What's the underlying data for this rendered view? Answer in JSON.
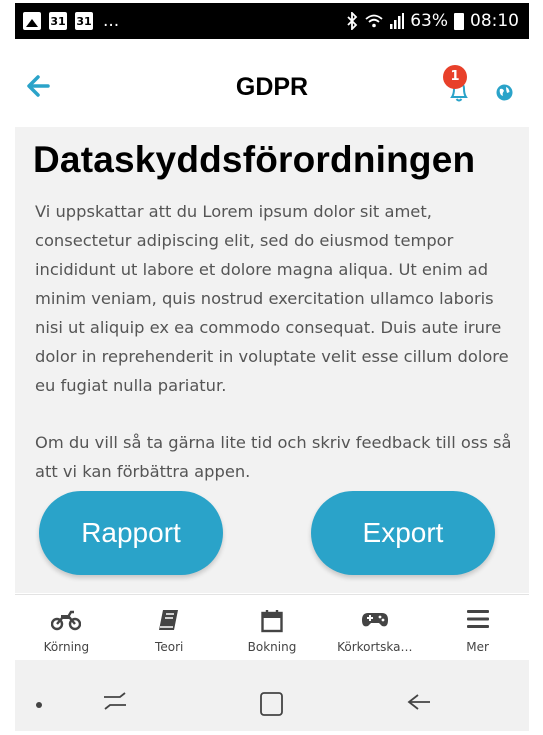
{
  "status_bar": {
    "left_icons": [
      "image-icon",
      "calendar-icon",
      "calendar-icon"
    ],
    "calendar_day": "31",
    "overflow": "...",
    "battery": "63%",
    "time": "08:10"
  },
  "header": {
    "title": "GDPR",
    "notification_count": "1"
  },
  "content": {
    "heading": "Dataskyddsförordningen",
    "paragraph1": "Vi uppskattar att du Lorem ipsum dolor sit amet, consectetur adipiscing elit, sed do eiusmod tempor incididunt ut labore et dolore magna aliqua. Ut enim ad minim veniam, quis nostrud exercitation ullamco laboris nisi ut aliquip ex ea commodo consequat. Duis aute irure dolor in reprehenderit in voluptate velit esse cillum dolore eu fugiat nulla pariatur.",
    "paragraph2": "Om du vill så ta gärna lite tid och skriv feedback till oss så att vi kan förbättra appen."
  },
  "buttons": {
    "rapport": "Rapport",
    "export": "Export"
  },
  "tabs": [
    {
      "label": "Körning",
      "icon": "motorcycle-icon"
    },
    {
      "label": "Teori",
      "icon": "book-icon"
    },
    {
      "label": "Bokning",
      "icon": "calendar-icon"
    },
    {
      "label": "Körkortska…",
      "icon": "gamepad-icon"
    },
    {
      "label": "Mer",
      "icon": "menu-icon"
    }
  ],
  "colors": {
    "accent": "#2aa3c9",
    "badge": "#e8402a",
    "content_bg": "#f2f2f2"
  }
}
